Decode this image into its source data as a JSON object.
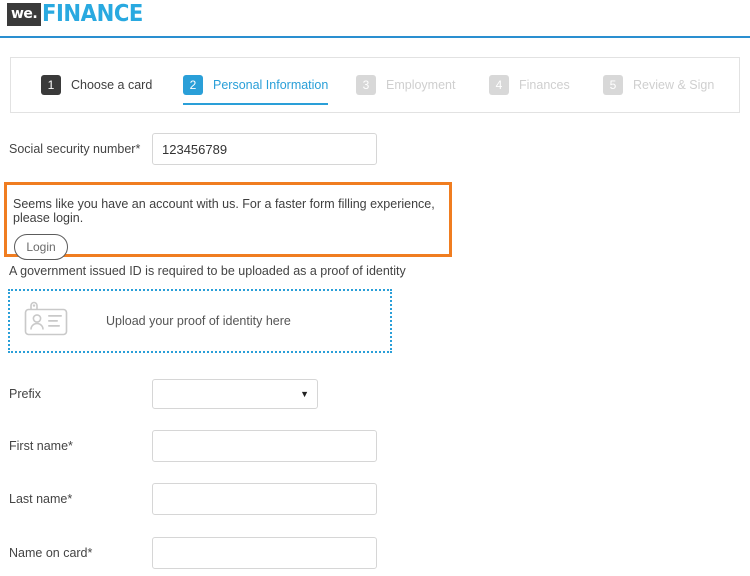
{
  "brand": {
    "badge_text": "we.",
    "name": "FINANCE",
    "accent_color": "#29a9e0",
    "badge_color": "#3a3a3a"
  },
  "stepper": {
    "steps": [
      {
        "number": "1",
        "label": "Choose a card",
        "state": "done"
      },
      {
        "number": "2",
        "label": "Personal Information",
        "state": "active"
      },
      {
        "number": "3",
        "label": "Employment",
        "state": "todo"
      },
      {
        "number": "4",
        "label": "Finances",
        "state": "todo"
      },
      {
        "number": "5",
        "label": "Review & Sign",
        "state": "todo"
      }
    ]
  },
  "form": {
    "ssn": {
      "label": "Social security number*",
      "value": "123456789",
      "placeholder": ""
    },
    "prefix": {
      "label": "Prefix",
      "value": "",
      "caret": "▼"
    },
    "first_name": {
      "label": "First name*",
      "value": "",
      "placeholder": ""
    },
    "last_name": {
      "label": "Last name*",
      "value": "",
      "placeholder": ""
    },
    "name_on_card": {
      "label": "Name on card*",
      "value": "",
      "placeholder": ""
    }
  },
  "alert": {
    "message": "Seems like you have an account with us. For a faster form filling experience, please login.",
    "button_label": "Login",
    "border_color": "#f07d20"
  },
  "upload": {
    "help_text": "A government issued ID is required to be uploaded as a proof of identity",
    "drop_text": "Upload your proof of identity here",
    "icon": "id-card-icon",
    "border_color": "#2a9fd8"
  }
}
